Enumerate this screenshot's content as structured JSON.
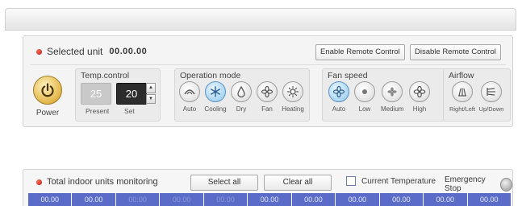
{
  "selected_unit": {
    "label": "Selected unit",
    "value": "00.00.00"
  },
  "remote": {
    "enable_label": "Enable Remote Control",
    "disable_label": "Disable Remote Control"
  },
  "power": {
    "label": "Power"
  },
  "temp_control": {
    "title": "Temp.control",
    "present_value": "25",
    "set_value": "20",
    "present_label": "Present",
    "set_label": "Set"
  },
  "operation_mode": {
    "title": "Operation mode",
    "items": [
      {
        "label": "Auto",
        "icon": "auto-mode-icon",
        "active": false
      },
      {
        "label": "Cooling",
        "icon": "snowflake-icon",
        "active": true
      },
      {
        "label": "Dry",
        "icon": "droplet-icon",
        "active": false
      },
      {
        "label": "Fan",
        "icon": "fan-icon",
        "active": false
      },
      {
        "label": "Heating",
        "icon": "sun-icon",
        "active": false
      }
    ]
  },
  "fan_speed": {
    "title": "Fan speed",
    "items": [
      {
        "label": "Auto",
        "icon": "fan-auto-icon",
        "active": true
      },
      {
        "label": "Low",
        "icon": "fan-low-icon",
        "active": false
      },
      {
        "label": "Medium",
        "icon": "fan-medium-icon",
        "active": false
      },
      {
        "label": "High",
        "icon": "fan-high-icon",
        "active": false
      }
    ]
  },
  "airflow": {
    "title": "Airflow",
    "items": [
      {
        "label": "Right/Left",
        "icon": "swing-horizontal-icon"
      },
      {
        "label": "Up/Down",
        "icon": "swing-vertical-icon"
      }
    ]
  },
  "monitoring": {
    "title": "Total indoor units monitoring",
    "select_all_label": "Select all",
    "clear_all_label": "Clear all",
    "current_temp_label": "Current Temperature",
    "emergency_stop_label": "Emergency Stop",
    "units": [
      "00.00",
      "00.00",
      "00.00",
      "00.00",
      "00.00",
      "00.00",
      "00.00",
      "00.00",
      "00.00",
      "00.00",
      "00.00"
    ]
  },
  "colors": {
    "active_mode": "#a5d3f2",
    "unit_cell": "#5a6cc7",
    "status_led": "#d0281a",
    "power_button": "#e3b64a"
  }
}
